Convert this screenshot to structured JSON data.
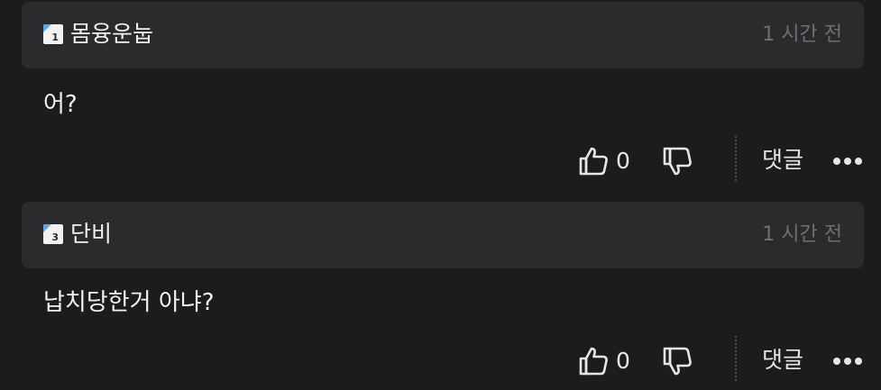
{
  "comments": [
    {
      "level": "1",
      "username": "몸융운눕",
      "time": "1 시간 전",
      "text": "어?",
      "likes": "0",
      "reply_label": "댓글",
      "badge_color": "#5fa8e6"
    },
    {
      "level": "3",
      "username": "단비",
      "time": "1 시간 전",
      "text": "납치당한거 아냐?",
      "likes": "0",
      "reply_label": "댓글",
      "badge_color": "#5fa8e6"
    }
  ],
  "icons": {
    "like": "thumbs-up-icon",
    "dislike": "thumbs-down-icon",
    "more": "more-icon"
  },
  "colors": {
    "background": "#1c1c1e",
    "header_background": "#2b2b2e",
    "text": "#f2f2f2",
    "muted_text": "#6f6f74"
  }
}
